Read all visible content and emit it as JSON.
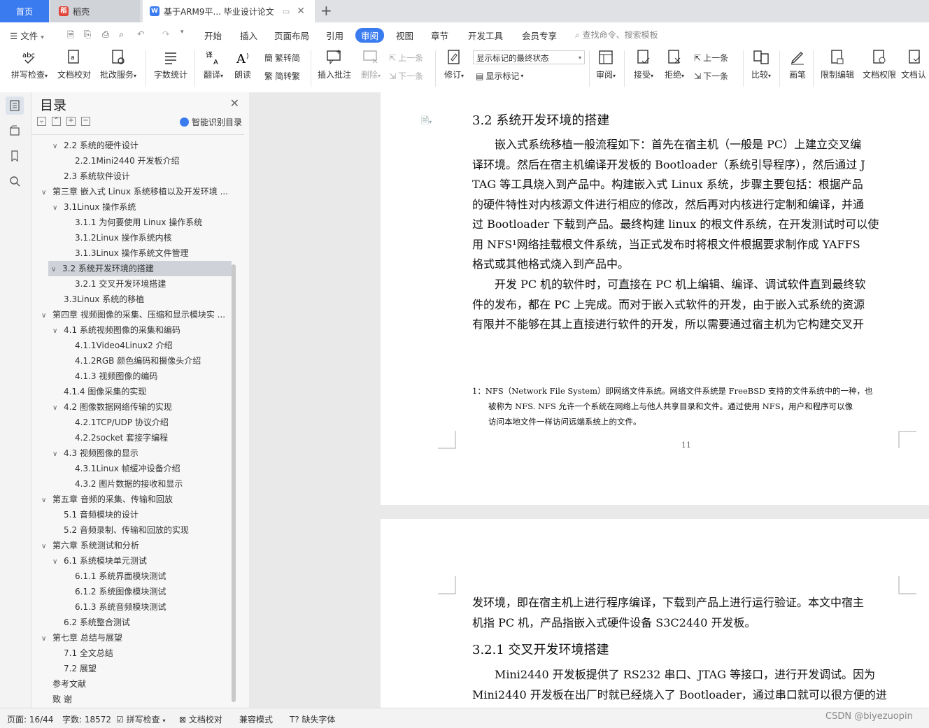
{
  "tabs": {
    "home": "首页",
    "daoke": "稻壳",
    "document": "基于ARM9平... 毕业设计论文"
  },
  "menu": {
    "file": "文件",
    "items": [
      "开始",
      "插入",
      "页面布局",
      "引用",
      "审阅",
      "视图",
      "章节",
      "开发工具",
      "会员专享"
    ],
    "active": "审阅",
    "search_placeholder": "查找命令、搜索模板"
  },
  "ribbon": {
    "spell_check": "拼写检查",
    "doc_proof": "文档校对",
    "annotate_service": "批改服务",
    "word_count": "字数统计",
    "translate": "翻译",
    "read_aloud": "朗读",
    "trad_to_simp": "繁转简",
    "simp_to_trad": "简转繁",
    "insert_comment": "插入批注",
    "delete": "删除",
    "prev_comment": "上一条",
    "next_comment": "下一条",
    "track_changes": "修订",
    "markup_state": "显示标记的最终状态",
    "show_markup": "显示标记",
    "review": "审阅",
    "accept": "接受",
    "reject": "拒绝",
    "prev_change": "上一条",
    "next_change": "下一条",
    "compare": "比较",
    "pen": "画笔",
    "restrict_edit": "限制编辑",
    "doc_permission": "文档权限",
    "doc_verify": "文档认"
  },
  "toc": {
    "title": "目录",
    "smart_label": "智能识别目录",
    "items": [
      {
        "text": "2.2 系统的硬件设计",
        "level": 2,
        "tri": true
      },
      {
        "text": "2.2.1Mini2440 开发板介绍",
        "level": 3,
        "tri": false
      },
      {
        "text": "2.3  系统软件设计",
        "level": 2,
        "tri": false
      },
      {
        "text": "第三章  嵌入式 Linux 系统移植以及开发环境 ...",
        "level": 1,
        "tri": true
      },
      {
        "text": "3.1Linux 操作系统",
        "level": 2,
        "tri": true
      },
      {
        "text": "3.1.1 为何要使用 Linux 操作系统",
        "level": 3,
        "tri": false
      },
      {
        "text": "3.1.2Linux 操作系统内核",
        "level": 3,
        "tri": false
      },
      {
        "text": "3.1.3Linux 操作系统文件管理",
        "level": 3,
        "tri": false
      },
      {
        "text": "3.2  系统开发环境的搭建",
        "level": 2,
        "tri": true,
        "selected": true
      },
      {
        "text": "3.2.1 交叉开发环境搭建",
        "level": 3,
        "tri": false
      },
      {
        "text": "3.3Linux 系统的移植",
        "level": 2,
        "tri": false
      },
      {
        "text": "第四章  视频图像的采集、压缩和显示模块实 ...",
        "level": 1,
        "tri": true
      },
      {
        "text": "4.1 系统视频图像的采集和编码",
        "level": 2,
        "tri": true
      },
      {
        "text": "4.1.1Video4Linux2 介绍",
        "level": 3,
        "tri": false
      },
      {
        "text": "4.1.2RGB 颜色编码和摄像头介绍",
        "level": 3,
        "tri": false
      },
      {
        "text": "4.1.3 视频图像的编码",
        "level": 3,
        "tri": false
      },
      {
        "text": "4.1.4 图像采集的实现",
        "level": 2,
        "tri": false
      },
      {
        "text": "4.2 图像数据网络传输的实现",
        "level": 2,
        "tri": true
      },
      {
        "text": "4.2.1TCP/UDP 协议介绍",
        "level": 3,
        "tri": false
      },
      {
        "text": "4.2.2socket 套接字编程",
        "level": 3,
        "tri": false
      },
      {
        "text": "4.3 视频图像的显示",
        "level": 2,
        "tri": true
      },
      {
        "text": "4.3.1Linux 帧缓冲设备介绍",
        "level": 3,
        "tri": false
      },
      {
        "text": "4.3.2 图片数据的接收和显示",
        "level": 3,
        "tri": false
      },
      {
        "text": "第五章  音频的采集、传输和回放",
        "level": 1,
        "tri": true
      },
      {
        "text": "5.1 音频模块的设计",
        "level": 2,
        "tri": false
      },
      {
        "text": "5.2 音频录制、传输和回放的实现",
        "level": 2,
        "tri": false
      },
      {
        "text": "第六章  系统测试和分析",
        "level": 1,
        "tri": true
      },
      {
        "text": "6.1 系统模块单元测试",
        "level": 2,
        "tri": true
      },
      {
        "text": "6.1.1 系统界面模块测试",
        "level": 3,
        "tri": false
      },
      {
        "text": "6.1.2 系统图像模块测试",
        "level": 3,
        "tri": false
      },
      {
        "text": "6.1.3 系统音频模块测试",
        "level": 3,
        "tri": false
      },
      {
        "text": "6.2 系统整合测试",
        "level": 2,
        "tri": false
      },
      {
        "text": "第七章  总结与展望",
        "level": 1,
        "tri": true
      },
      {
        "text": "7.1 全文总结",
        "level": 2,
        "tri": false
      },
      {
        "text": "7.2 展望",
        "level": 2,
        "tri": false
      },
      {
        "text": "参考文献",
        "level": 1,
        "tri": false
      },
      {
        "text": "致    谢",
        "level": 1,
        "tri": false
      }
    ]
  },
  "page1": {
    "heading": "3.2  系统开发环境的搭建",
    "lines1": [
      "　　嵌入式系统移植一般流程如下：首先在宿主机（一般是 PC）上建立交叉编",
      "译环境。然后在宿主机编译开发板的 Bootloader（系统引导程序），然后通过 J",
      "TAG 等工具烧入到产品中。构建嵌入式 Linux 系统，步骤主要包括：根据产品",
      "的硬件特性对内核源文件进行相应的修改，然后再对内核进行定制和编译，并通",
      "过 Bootloader 下载到产品。最终构建 linux 的根文件系统，在开发测试时可以使",
      "用 NFS¹网络挂载根文件系统，当正式发布时将根文件根据要求制作成 YAFFS",
      "格式或其他格式烧入到产品中。"
    ],
    "lines2": [
      "　　开发 PC 机的软件时，可直接在 PC 机上编辑、编译、调试软件直到最终软",
      "件的发布，都在 PC 上完成。而对于嵌入式软件的开发，由于嵌入式系统的资源",
      "有限并不能够在其上直接进行软件的开发，所以需要通过宿主机为它构建交叉开"
    ],
    "footnote": [
      "1：NFS（Network  File  System）即网络文件系统。网络文件系统是 FreeBSD 支持的文件系统中的一种，也",
      "　　被称为 NFS. NFS 允许一个系统在网络上与他人共享目录和文件。通过使用 NFS，用户和程序可以像",
      "　　访问本地文件一样访问远端系统上的文件。"
    ],
    "page_number": "11"
  },
  "page2": {
    "lines1": [
      "发环境，即在宿主机上进行程序编译，下载到产品上进行运行验证。本文中宿主",
      "机指 PC 机，产品指嵌入式硬件设备 S3C2440 开发板。"
    ],
    "heading": "3.2.1 交叉开发环境搭建",
    "lines2": [
      "　　Mini2440 开发板提供了 RS232 串口、JTAG 等接口，进行开发调试。因为",
      "Mini2440 开发板在出厂时就已经烧入了 Bootloader，通过串口就可以很方便的进"
    ]
  },
  "status": {
    "page": "页面: 16/44",
    "words": "字数: 18572",
    "spell": "拼写检查",
    "proof": "文档校对",
    "compat": "兼容模式",
    "missing_font": "缺失字体",
    "watermark": "CSDN @biyezuopin"
  },
  "colors": {
    "accent": "#3a7bf0",
    "wps_red": "#e0453a"
  }
}
